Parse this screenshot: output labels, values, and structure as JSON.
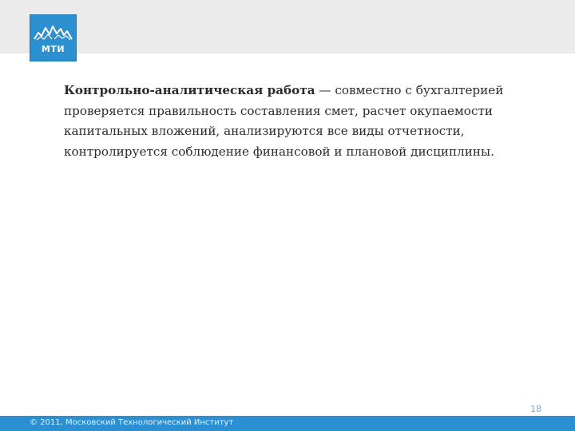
{
  "logo": {
    "text": "МТИ",
    "icon": "mountain-peaks-icon"
  },
  "content": {
    "term": "Контрольно-аналитическая работа",
    "text": " — совместно с бухгалтерией проверяется правильность составления смет, расчет окупаемости капитальных вложений, анализируются все виды отчетности, контролируется соблюдение финансовой и плановой дисциплины."
  },
  "page_number": "18",
  "footer": {
    "copyright": "© 2011, Московский Технологический Институт"
  },
  "colors": {
    "accent": "#2b8fd2",
    "header_band": "#ebebeb",
    "text": "#2b2b2b"
  }
}
